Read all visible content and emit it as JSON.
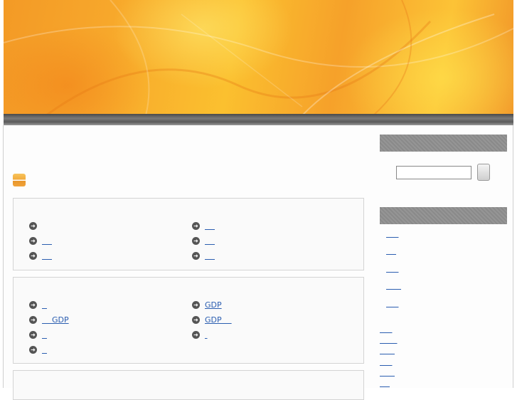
{
  "banner": {
    "description_icon": "orange-leaf-header"
  },
  "colors": {
    "banner": "#f7a72b",
    "link": "#2a5db0",
    "sidebar_header": "#8f8f8f",
    "title_icon": "#f2a93a"
  },
  "main": {
    "sections": [
      {
        "items": [
          {
            "label": "",
            "icon": "arrow-right-circle-icon"
          },
          {
            "label": "    ",
            "icon": "arrow-right-circle-icon"
          },
          {
            "label": "    ",
            "icon": "arrow-right-circle-icon"
          },
          {
            "label": "    ",
            "icon": "arrow-right-circle-icon"
          },
          {
            "label": "    ",
            "icon": "arrow-right-circle-icon"
          },
          {
            "label": "    ",
            "icon": "arrow-right-circle-icon"
          }
        ]
      },
      {
        "items": [
          {
            "label": "  ",
            "icon": "arrow-right-circle-icon"
          },
          {
            "label": "GDP",
            "icon": "arrow-right-circle-icon"
          },
          {
            "label": "    GDP",
            "icon": "arrow-right-circle-icon"
          },
          {
            "label": "GDP    ",
            "icon": "arrow-right-circle-icon"
          },
          {
            "label": "  ",
            "icon": "arrow-right-circle-icon"
          },
          {
            "label": " ",
            "icon": "arrow-right-circle-icon"
          },
          {
            "label": "  ",
            "icon": "arrow-right-circle-icon"
          }
        ]
      }
    ]
  },
  "sidebar": {
    "search": {
      "value": "",
      "button_label": ""
    },
    "links": [
      "     ",
      "    ",
      "     ",
      "      ",
      "     "
    ],
    "bottom_links": [
      "     ",
      "       ",
      "      ",
      "     ",
      "      ",
      "    "
    ]
  }
}
